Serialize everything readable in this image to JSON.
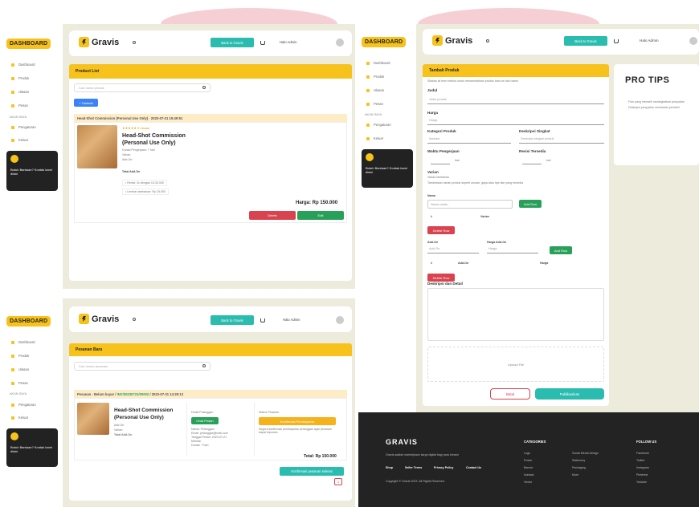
{
  "brand": {
    "logo": "Gravis",
    "dashboard_badge": "DASHBOARD",
    "accent": "#f6c21b",
    "teal": "#2bbcb0"
  },
  "sidebar": {
    "items": [
      "Dashboard",
      "Produk",
      "Ulasan",
      "Pesan"
    ],
    "section": "AKUN SAYA",
    "account_items": [
      "Pengaturan",
      "Keluar"
    ],
    "promo_text": "Butuh Bantuan? Kontak kami disini"
  },
  "header": {
    "back_button": "Back to Gravis",
    "user_greeting": "Halo",
    "user_name": "Admin"
  },
  "product_list": {
    "title": "Product List",
    "search_placeholder": "Cari nama produk",
    "add_button": "+ Tambah",
    "row_header": "Head-Shot Commission (Personal Use Only) · 2023-07-21 15:49:51",
    "stars": "★★★★★ 5 ulasan",
    "product_title": "Head-Shot Commission (Personal Use Only)",
    "details": [
      "Durasi Pengerjaan: 7 hari",
      "Varian:",
      "Add-On:",
      "Total Add-On"
    ],
    "note1": "• Revisi: 3x dengan 15-30.000",
    "note2": "• Lembar tambahan: Rp 15.000",
    "price_label": "Harga: Rp 150.000",
    "delete_button": "Delete",
    "edit_button": "Edit"
  },
  "orders": {
    "title": "Pesanan Baru",
    "search_placeholder": "Cari nomor pesanan",
    "row_header_prefix": "Pesanan - Belum bayar",
    "row_header_id": "INV/20230721/00002",
    "row_header_date": "2023-07-21 14:29:13",
    "product_title": "Head-Shot Commission (Personal Use Only)",
    "left_meta": [
      "Add-On",
      "Varian:",
      "Total Add-On"
    ],
    "middle_title": "Detail Pelanggan",
    "view_button": "Lihat Pesan",
    "middle_meta": [
      "Nama: Pelanggan",
      "Email: pelanggan@mail.com",
      "Tanggal Pesan: 2023-07-21",
      "Metode",
      "Durasi: 7 hari"
    ],
    "right_title": "Status Pesanan",
    "status_button": "Konfirmasi Pembayaran",
    "status_note": "Segera konfirmasi pembayaran pelanggan agar pesanan dapat diproses",
    "total": "Total: Rp 150.000",
    "confirm_button": "Konfirmasi pesanan selesai",
    "page_number": "1"
  },
  "add_product": {
    "title": "Tambah Produk",
    "intro": "Silakan isi form berikut untuk menambahkan produk baru ke toko kamu",
    "field_title": "Judul",
    "field_title_placeholder": "Judul produk",
    "field_price": "Harga",
    "field_price_placeholder": "Harga",
    "field_category": "Kategori Produk",
    "field_category_value": "Ilustrasi",
    "field_short_desc": "Deskripsi Singkat",
    "field_short_desc_placeholder": "Deskripsi singkat produk",
    "field_duration": "Waktu Pengerjaan",
    "field_duration_unit": "hari",
    "field_revision": "Revisi Tersedia",
    "field_revision_unit": "kali",
    "field_variant": "Varian",
    "variant_sub": "Varian tambahan",
    "variant_desc": "Tambahkan varian produk seperti ukuran, gaya atau tipe lain yang tersedia",
    "variant_name_label": "Nama",
    "variant_name_placeholder": "Nama varian",
    "add_variant_button": "Add Row",
    "col_no": "#",
    "col_variant": "Varian",
    "delete_row_button": "Delete Row",
    "addon_label": "Add-On",
    "addon_placeholder": "Add-On",
    "addon_price_label": "Harga Add-On",
    "addon_price_placeholder": "Harga",
    "add_addon_button": "Add Row",
    "col_addon": "Add-On",
    "col_price": "Harga",
    "delete_addon_button": "Delete Row",
    "desc_label": "Deskripsi dan Detail",
    "upload_label": "Upload File",
    "cancel_button": "Batal",
    "publish_button": "Publikasikan"
  },
  "tips": {
    "title": "PRO TIPS",
    "items": [
      "Foto yang menarik meningkatkan penjualan",
      "Deskripsi yang jelas membantu pembeli"
    ]
  },
  "footer": {
    "logo": "GRAVIS",
    "tagline": "Gravis adalah marketplace karya digital bagi para kreator",
    "links": [
      "Shop",
      "Seller Terms",
      "Privacy Policy",
      "Contact Us"
    ],
    "copyright": "Copyright © Gravis 2023. All Rights Reserved.",
    "col1_title": "CATEGORIES",
    "col1": [
      "Logo",
      "Poster",
      "Banner",
      "Ilustrasi",
      "Vector"
    ],
    "col2": [
      "Social Media Design",
      "Stationery",
      "Packaging",
      "More"
    ],
    "col3_title": "FOLLOW US",
    "col3": [
      "Facebook",
      "Twitter",
      "Instagram",
      "Pinterest",
      "Youtube"
    ]
  }
}
